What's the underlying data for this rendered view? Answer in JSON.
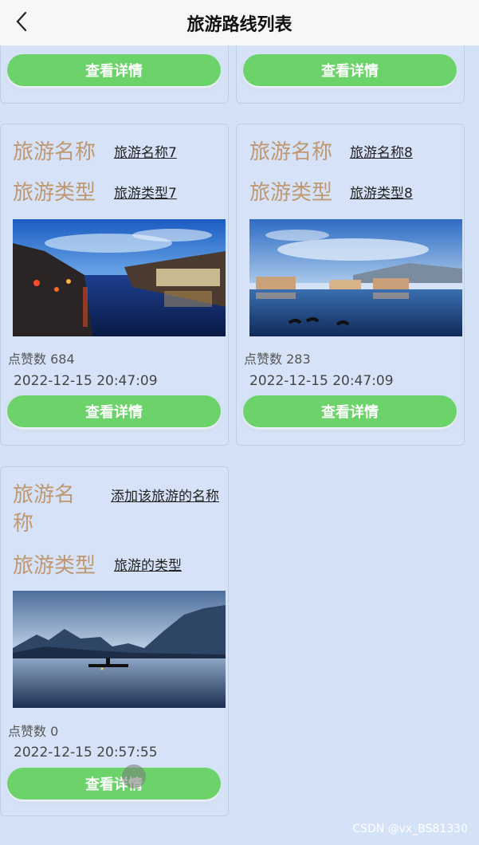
{
  "header": {
    "title": "旅游路线列表"
  },
  "labels": {
    "name": "旅游名称",
    "type": "旅游类型",
    "likes_prefix": "点赞数",
    "detail_button": "查看详情"
  },
  "cards": [
    {
      "name": "旅游名称7",
      "type": "旅游类型7",
      "likes": "684",
      "time": "2022-12-15 20:47:09"
    },
    {
      "name": "旅游名称8",
      "type": "旅游类型8",
      "likes": "283",
      "time": "2022-12-15 20:47:09"
    },
    {
      "name": "添加该旅游的名称",
      "type": "旅游的类型",
      "likes": "0",
      "time": "2022-12-15 20:57:55"
    }
  ],
  "top_partial_cards": [
    {
      "button": "查看详情"
    },
    {
      "button": "查看详情"
    }
  ],
  "watermark": "CSDN @vx_BS81330"
}
